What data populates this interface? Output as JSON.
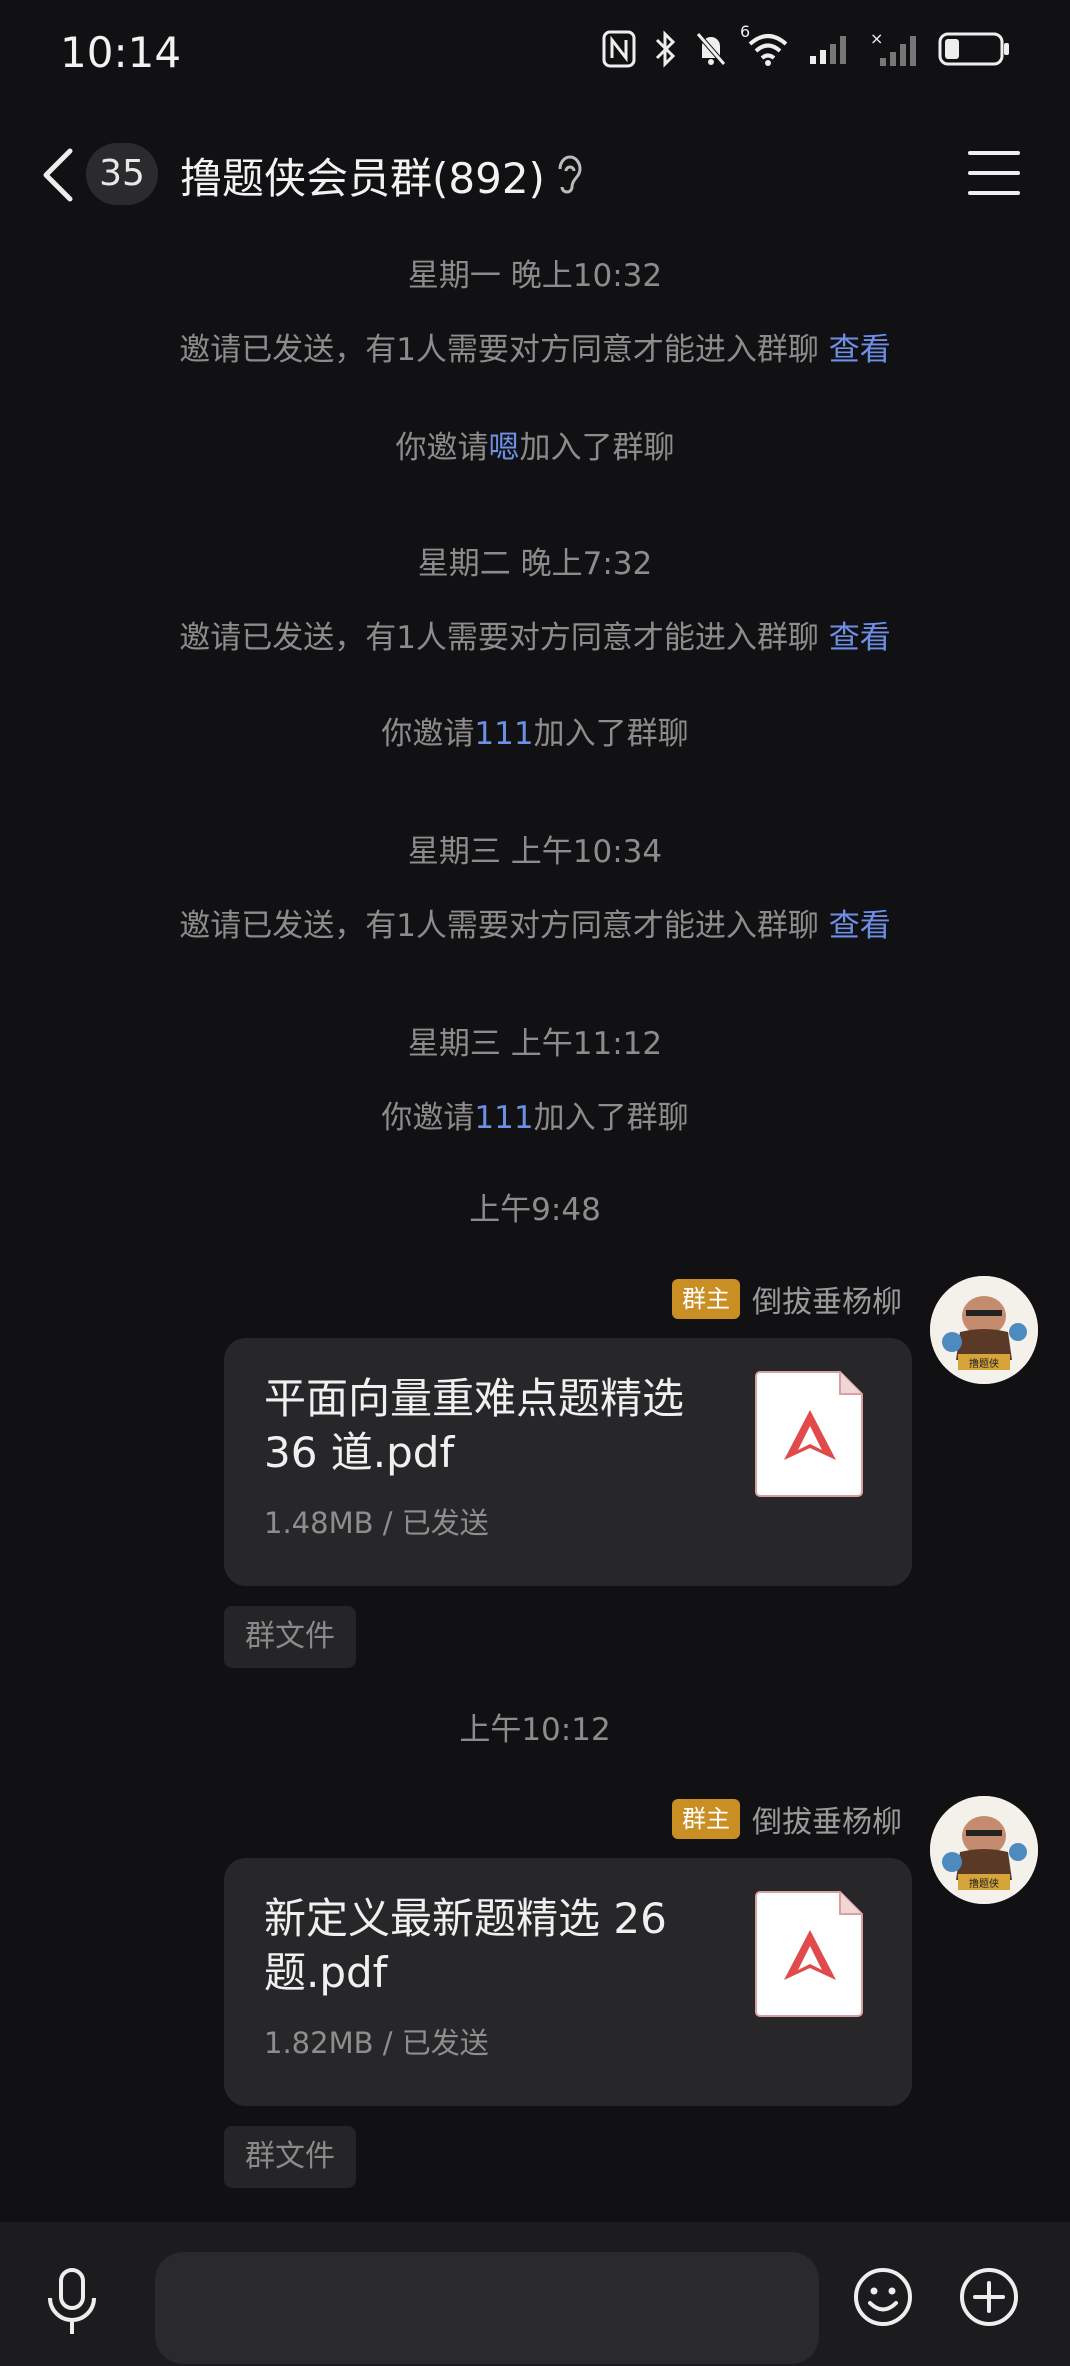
{
  "status_bar": {
    "time": "10:14",
    "icons": [
      "nfc-icon",
      "bluetooth-icon",
      "mute-icon",
      "wifi-icon",
      "signal-icon",
      "signal-off-icon",
      "battery-icon"
    ],
    "wifi_label": "6"
  },
  "header": {
    "unread_count": "35",
    "title": "撸题侠会员群(892)",
    "icons": [
      "back-icon",
      "ear-icon",
      "menu-icon"
    ]
  },
  "messages": {
    "t1": "星期一 晚上10:32",
    "invite1": {
      "text": "邀请已发送，有1人需要对方同意才能进入群聊",
      "link": "查看"
    },
    "join1": {
      "prefix": "你邀请",
      "name": "嗯",
      "suffix": "加入了群聊"
    },
    "t2": "星期二 晚上7:32",
    "invite2": {
      "text": "邀请已发送，有1人需要对方同意才能进入群聊",
      "link": "查看"
    },
    "join2": {
      "prefix": "你邀请",
      "name": "111",
      "suffix": "加入了群聊"
    },
    "t3": "星期三 上午10:34",
    "invite3": {
      "text": "邀请已发送，有1人需要对方同意才能进入群聊",
      "link": "查看"
    },
    "t4": "星期三 上午11:12",
    "join3": {
      "prefix": "你邀请",
      "name": "111",
      "suffix": "加入了群聊"
    },
    "t5": "上午9:48",
    "file1": {
      "role": "群主",
      "sender": "倒拔垂杨柳",
      "name": "平面向量重难点题精选36 道.pdf",
      "meta": "1.48MB / 已发送",
      "chip": "群文件",
      "avatar_text": "撸题侠"
    },
    "t6": "上午10:12",
    "file2": {
      "role": "群主",
      "sender": "倒拔垂杨柳",
      "name": "新定义最新题精选 26 题.pdf",
      "meta": "1.82MB / 已发送",
      "chip": "群文件",
      "avatar_text": "撸题侠"
    }
  },
  "input_bar": {
    "placeholder": "",
    "icons": [
      "mic-icon",
      "emoji-icon",
      "plus-icon"
    ]
  },
  "colors": {
    "background": "#111113",
    "link": "#6e8fe6",
    "role_badge": "#c98f24",
    "pdf_red": "#e04a4a"
  }
}
